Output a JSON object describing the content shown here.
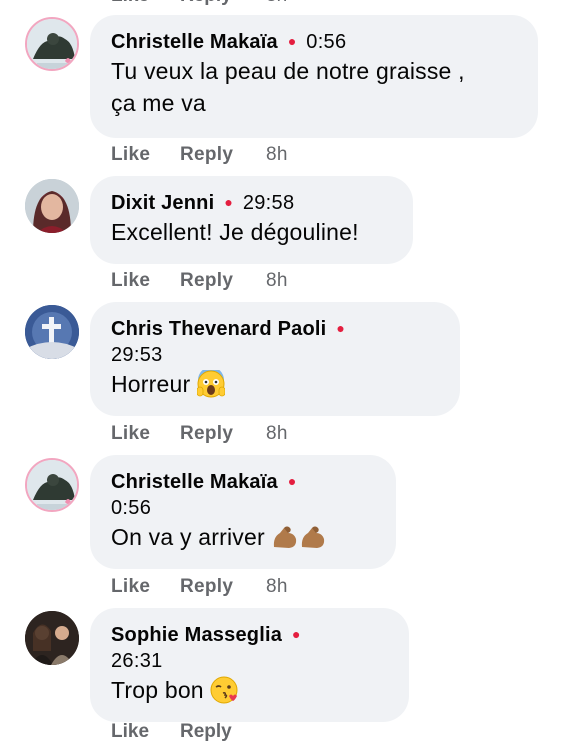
{
  "top_actions": {
    "like": "Like",
    "reply": "Reply",
    "age": "8h"
  },
  "comments": [
    {
      "author": "Christelle Makaïa",
      "timestamp": "0:56",
      "text_lines": [
        "Tu veux la peau de notre graisse ,",
        "ça me va"
      ],
      "emoji": "",
      "actions": {
        "like": "Like",
        "reply": "Reply",
        "age": "8h"
      }
    },
    {
      "author": "Dixit Jenni",
      "timestamp": "29:58",
      "text_lines": [
        "Excellent! Je dégouline!"
      ],
      "emoji": "",
      "actions": {
        "like": "Like",
        "reply": "Reply",
        "age": "8h"
      }
    },
    {
      "author": "Chris Thevenard Paoli",
      "timestamp": "29:53",
      "text_lines": [
        "Horreur"
      ],
      "emoji": "face-screaming-in-fear",
      "actions": {
        "like": "Like",
        "reply": "Reply",
        "age": "8h"
      }
    },
    {
      "author": "Christelle Makaïa",
      "timestamp": "0:56",
      "text_lines": [
        "On va y arriver"
      ],
      "emoji": "flexed-biceps-x2",
      "actions": {
        "like": "Like",
        "reply": "Reply",
        "age": "8h"
      }
    },
    {
      "author": "Sophie Masseglia",
      "timestamp": "26:31",
      "text_lines": [
        "Trop bon"
      ],
      "emoji": "face-blowing-kiss",
      "actions": {
        "like": "Like",
        "reply": "Reply",
        "age": ""
      }
    }
  ],
  "colors": {
    "bubble": "#f0f2f5",
    "muted": "#65676b",
    "dot": "#e41e3f"
  }
}
